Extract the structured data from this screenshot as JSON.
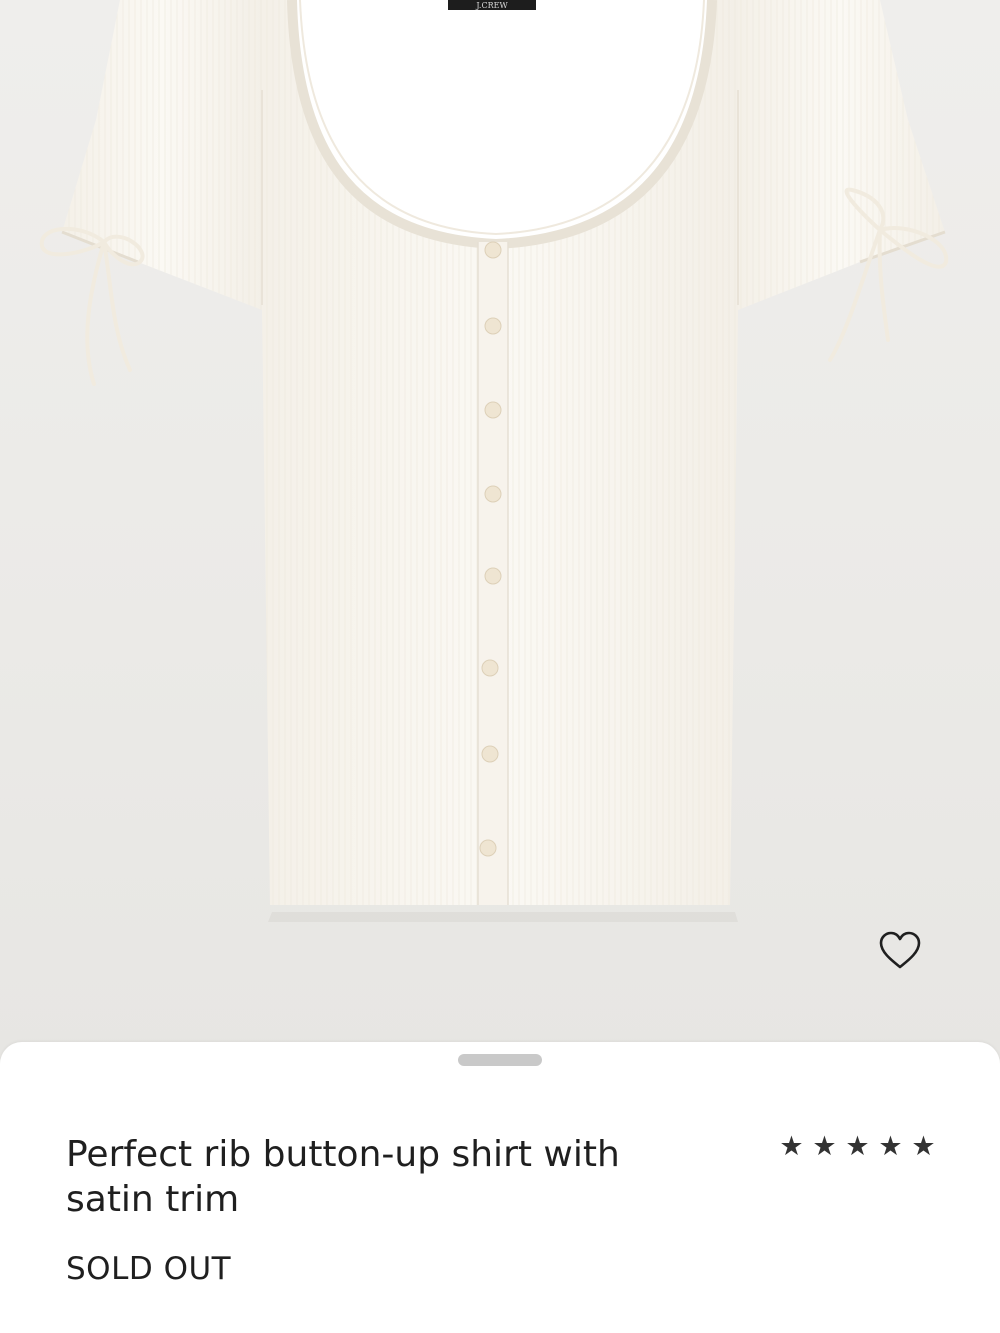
{
  "product": {
    "title": "Perfect rib button-up shirt with satin trim",
    "status": "SOLD OUT",
    "label_text": "J.CREW",
    "rating": {
      "value": 5,
      "max": 5,
      "stars": [
        "★",
        "★",
        "★",
        "★",
        "★"
      ]
    }
  },
  "icons": {
    "wishlist": "heart-outline-icon",
    "rating_star": "star-icon"
  },
  "colors": {
    "background": "#ecebe9",
    "garment": "#fbf8f2",
    "sheet": "#ffffff",
    "text": "#1f1f1f",
    "stars": "#333333",
    "grabber": "#c9c9c9"
  }
}
